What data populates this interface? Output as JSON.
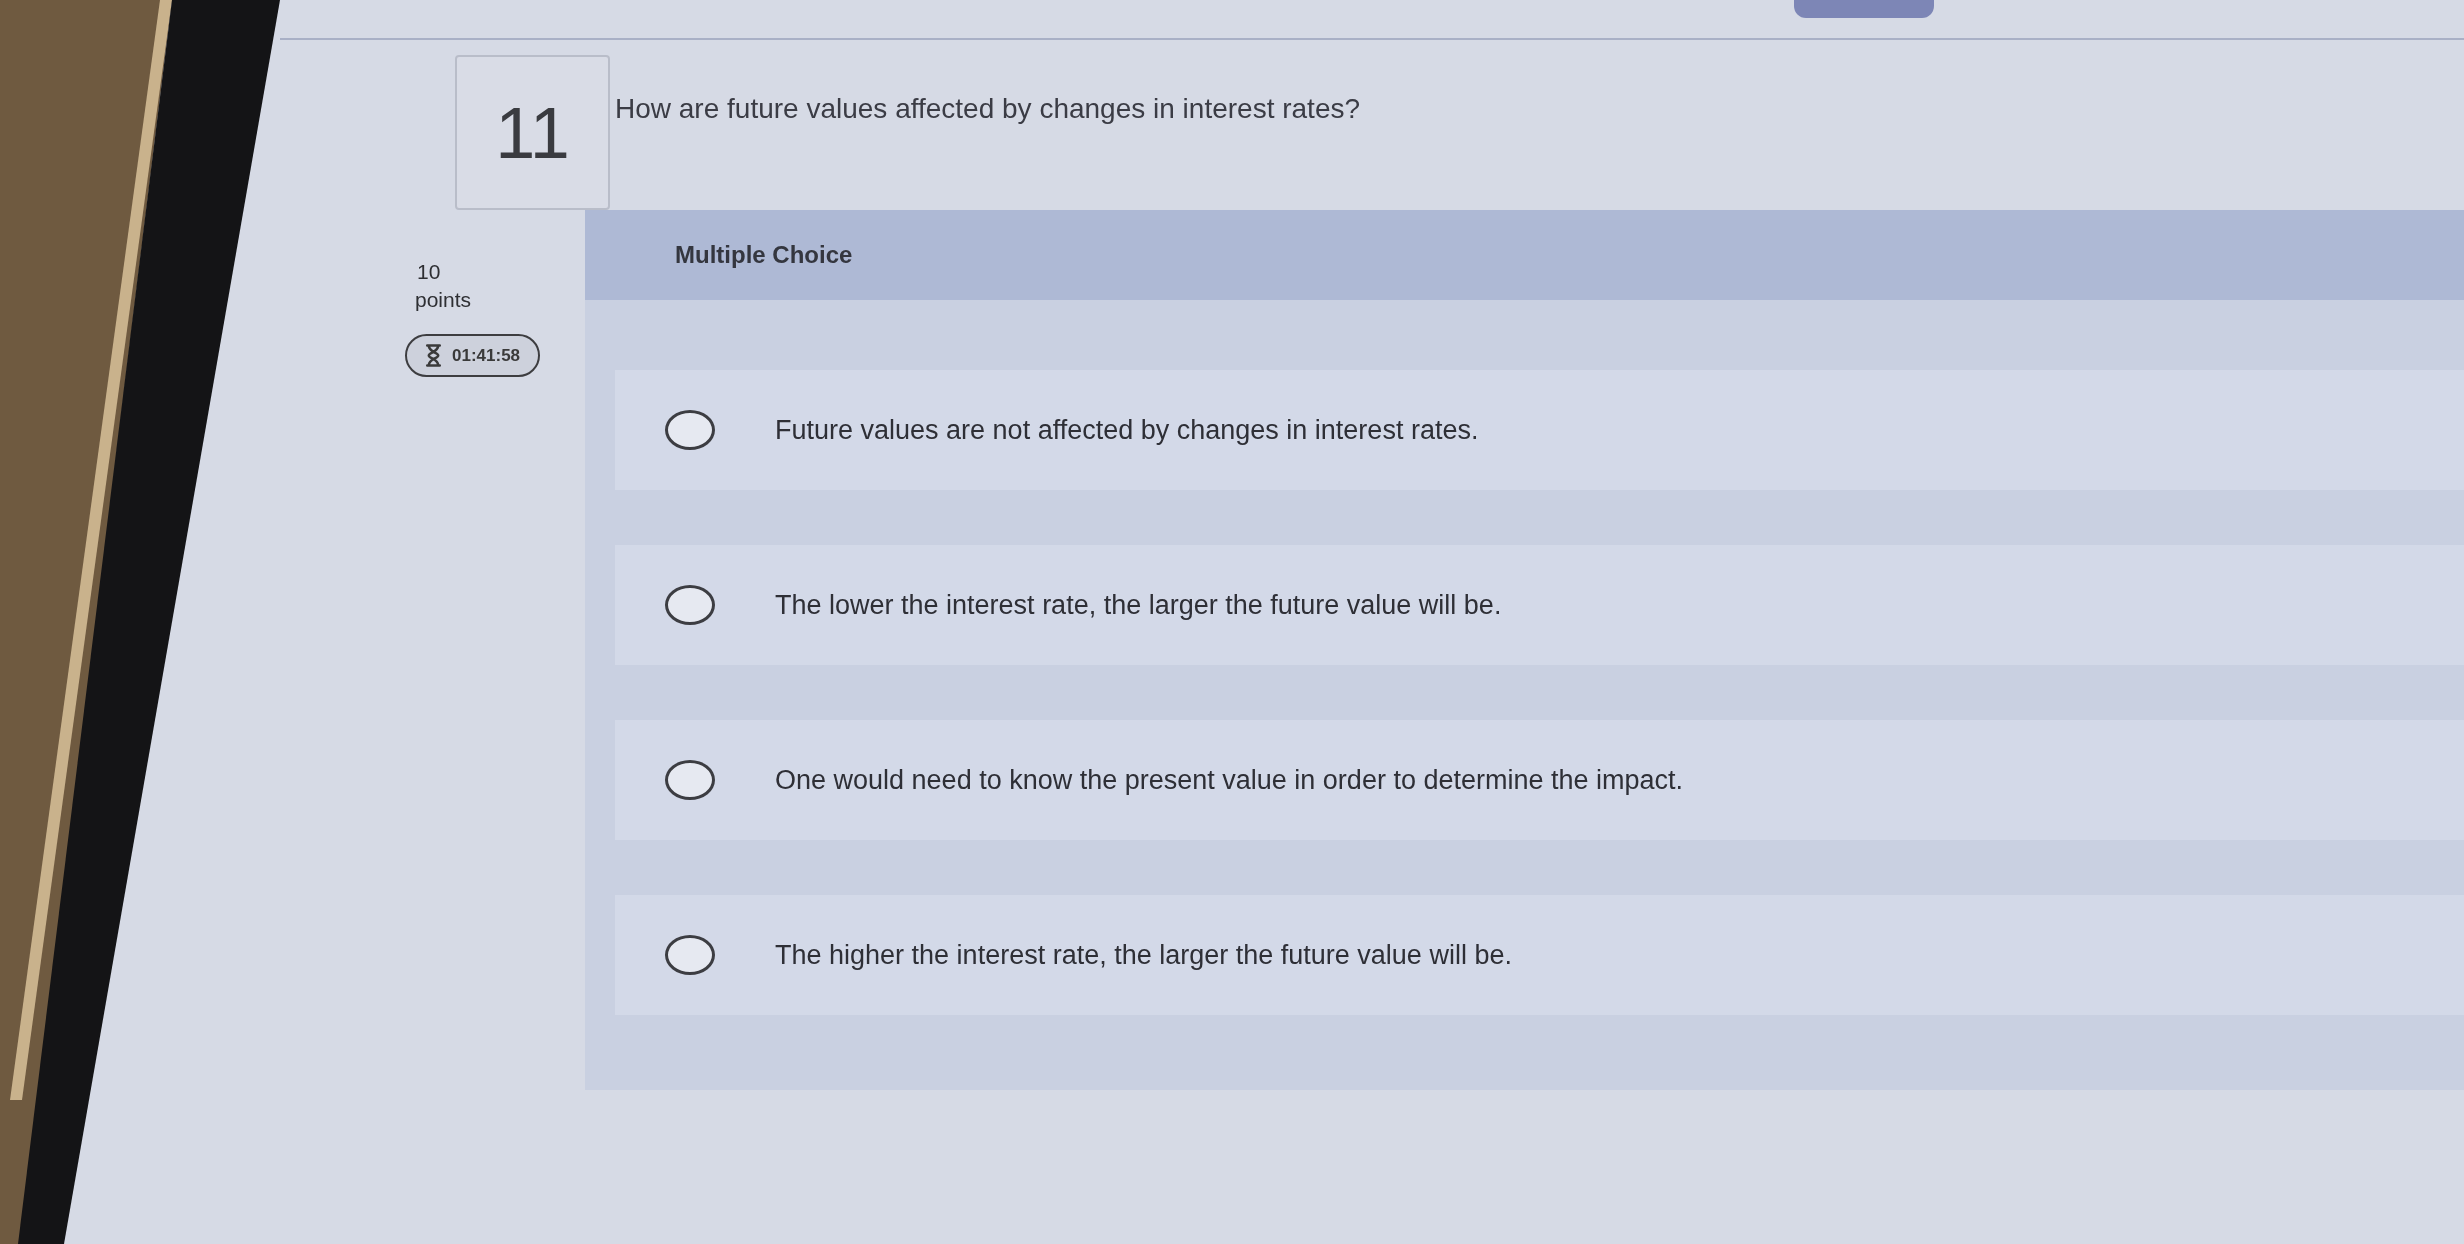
{
  "question": {
    "number": "11",
    "text": "How are future values affected by changes in interest rates?",
    "points": "10",
    "points_label": "points",
    "timer": "01:41:58"
  },
  "answer_panel": {
    "type_label": "Multiple Choice",
    "options": [
      {
        "text": "Future values are not affected by changes in interest rates.",
        "selected": false
      },
      {
        "text": "The lower the interest rate, the larger the future value will be.",
        "selected": false
      },
      {
        "text": "One would need to know the present value in order to determine the impact.",
        "selected": false
      },
      {
        "text": "The higher the interest rate, the larger the future value will be.",
        "selected": false
      }
    ]
  }
}
